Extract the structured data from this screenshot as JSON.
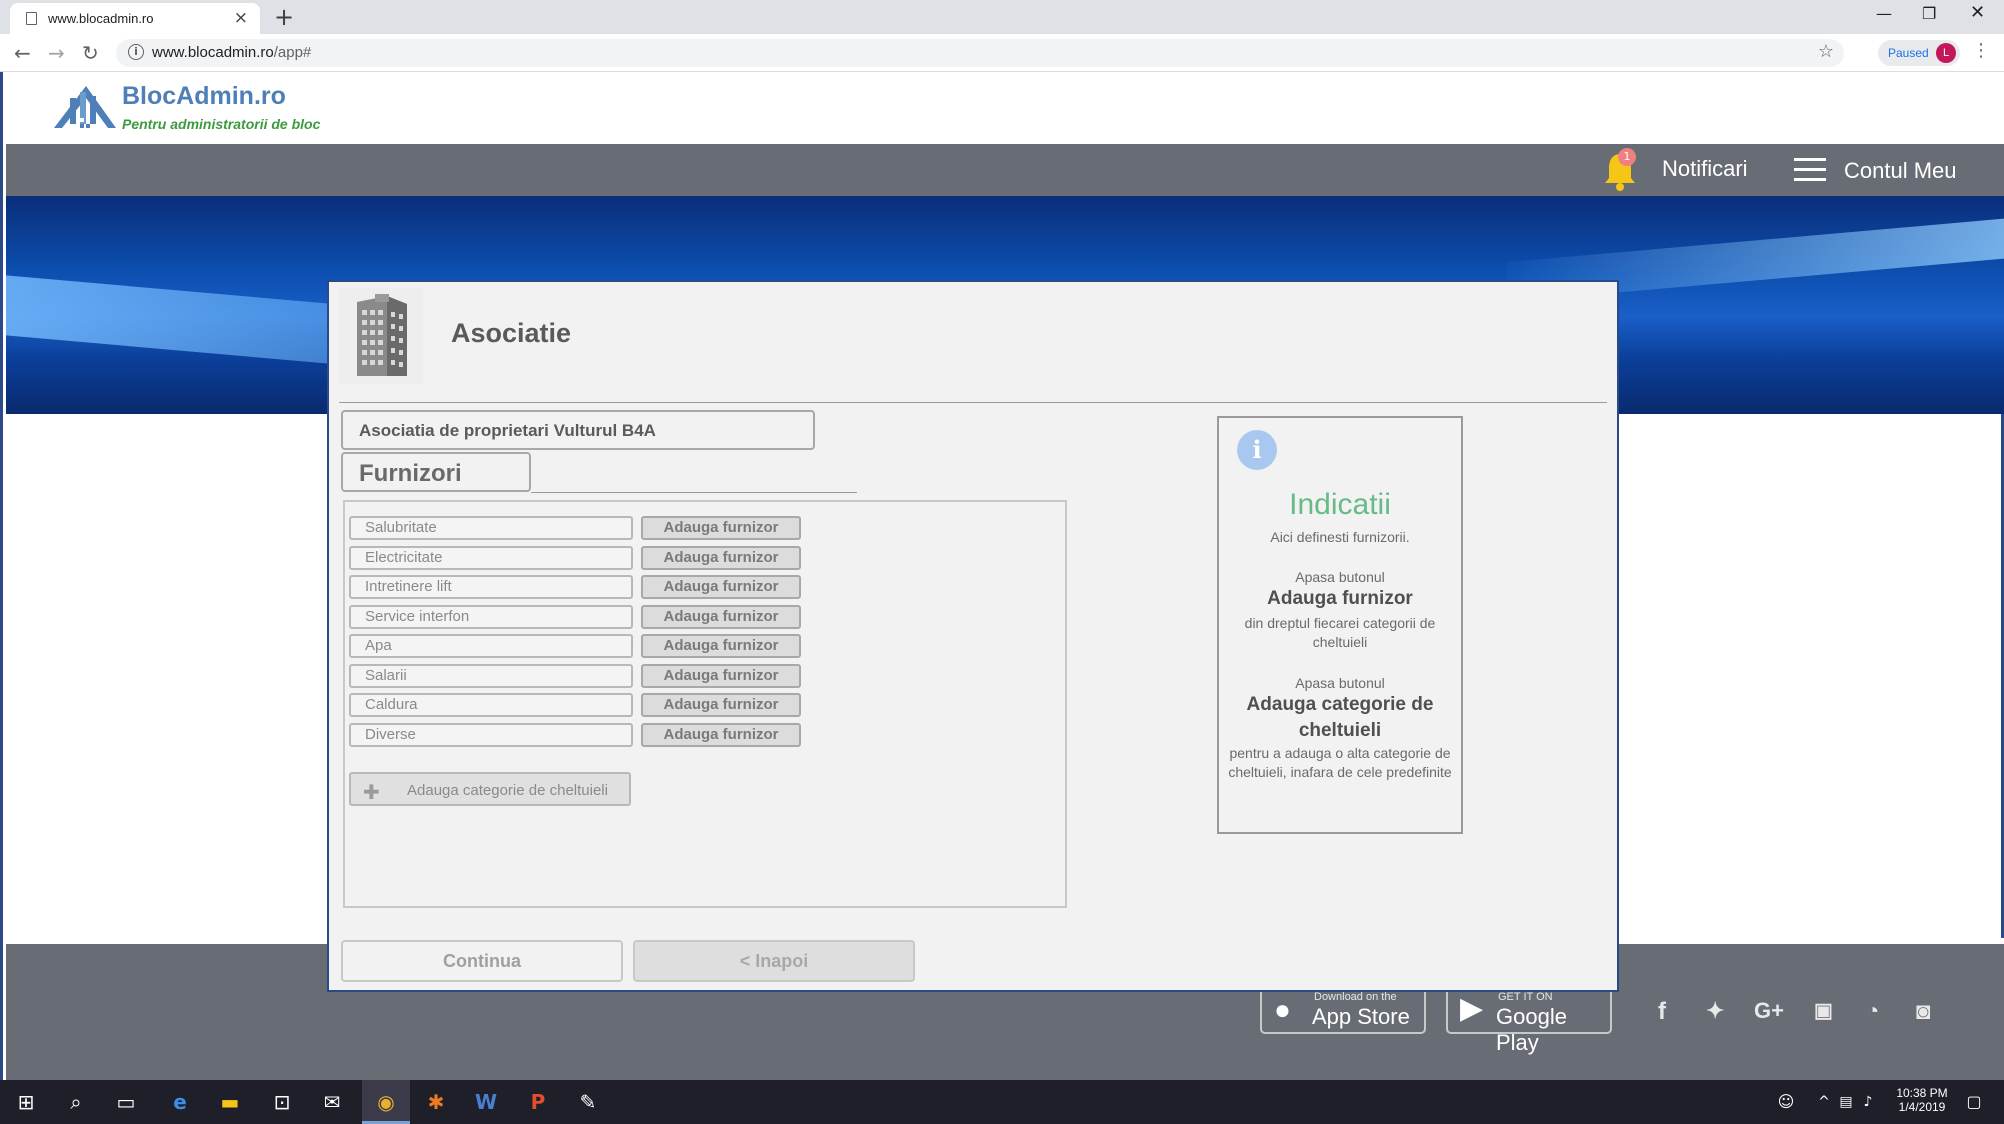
{
  "browser": {
    "tab_title": "www.blocadmin.ro",
    "url_host": "www.blocadmin.ro",
    "url_path": "/app#",
    "paused_label": "Paused",
    "profile_initial": "L"
  },
  "site": {
    "brand": "BlocAdmin.ro",
    "tagline": "Pentru administratorii de bloc",
    "notifications_label": "Notificari",
    "notifications_count": "1",
    "account_label": "Contul Meu"
  },
  "card": {
    "title": "Asociatie",
    "association_name": "Asociatia de proprietari Vulturul B4A",
    "section_title": "Furnizori",
    "categories": [
      {
        "name": "Salubritate",
        "button": "Adauga furnizor"
      },
      {
        "name": "Electricitate",
        "button": "Adauga furnizor"
      },
      {
        "name": "Intretinere lift",
        "button": "Adauga furnizor"
      },
      {
        "name": "Service interfon",
        "button": "Adauga furnizor"
      },
      {
        "name": "Apa",
        "button": "Adauga furnizor"
      },
      {
        "name": "Salarii",
        "button": "Adauga furnizor"
      },
      {
        "name": "Caldura",
        "button": "Adauga furnizor"
      },
      {
        "name": "Diverse",
        "button": "Adauga furnizor"
      }
    ],
    "add_category_label": "Adauga categorie de cheltuieli",
    "continue_label": "Continua",
    "back_label": "< Inapoi"
  },
  "info": {
    "title": "Indicatii",
    "line1": "Aici definesti furnizorii.",
    "press1": "Apasa butonul",
    "bold1": "Adauga furnizor",
    "desc1": "din dreptul fiecarei categorii de cheltuieli",
    "press2": "Apasa butonul",
    "bold2": "Adauga categorie de cheltuieli",
    "desc2": "pentru a adauga o alta categorie de cheltuieli, inafara de cele predefinite"
  },
  "footer": {
    "appstore_small": "Download on the",
    "appstore_big": "App Store",
    "googleplay_small": "GET IT ON",
    "googleplay_big": "Google Play"
  },
  "taskbar": {
    "time": "10:38 PM",
    "date": "1/4/2019"
  },
  "colors": {
    "nav_bar": "#686c74",
    "brand_blue": "#4e7fb8",
    "tagline_green": "#3e9a3e",
    "info_title_green": "#66bb88",
    "card_border": "#2a4a8a"
  }
}
